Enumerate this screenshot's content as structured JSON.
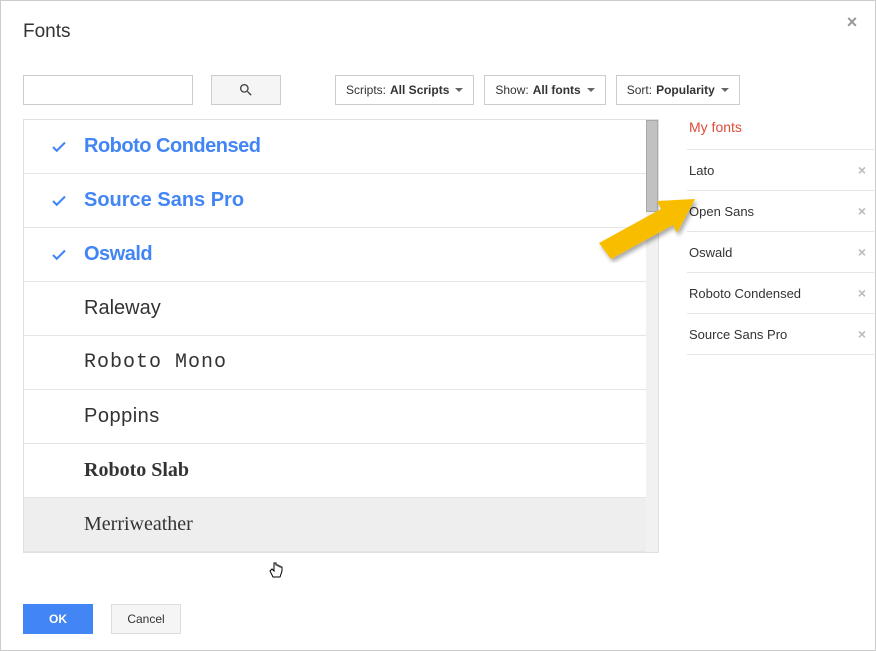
{
  "dialog": {
    "title": "Fonts",
    "ok_label": "OK",
    "cancel_label": "Cancel"
  },
  "search": {
    "value": "",
    "placeholder": ""
  },
  "filters": {
    "scripts": {
      "label": "Scripts:",
      "value": "All Scripts"
    },
    "show": {
      "label": "Show:",
      "value": "All fonts"
    },
    "sort": {
      "label": "Sort:",
      "value": "Popularity"
    }
  },
  "font_list": [
    {
      "name": "Roboto Condensed",
      "selected": true,
      "style_class": "narrow"
    },
    {
      "name": "Source Sans Pro",
      "selected": true,
      "style_class": "sans-light"
    },
    {
      "name": "Oswald",
      "selected": true,
      "style_class": "narrow"
    },
    {
      "name": "Raleway",
      "selected": false,
      "style_class": "sans-light"
    },
    {
      "name": "Roboto Mono",
      "selected": false,
      "style_class": "mono"
    },
    {
      "name": "Poppins",
      "selected": false,
      "style_class": "pop"
    },
    {
      "name": "Roboto Slab",
      "selected": false,
      "style_class": "slab"
    },
    {
      "name": "Merriweather",
      "selected": false,
      "style_class": "serif",
      "hovered": true
    }
  ],
  "sidebar": {
    "title": "My fonts",
    "items": [
      {
        "name": "Lato"
      },
      {
        "name": "Open Sans"
      },
      {
        "name": "Oswald"
      },
      {
        "name": "Roboto Condensed"
      },
      {
        "name": "Source Sans Pro"
      }
    ]
  }
}
